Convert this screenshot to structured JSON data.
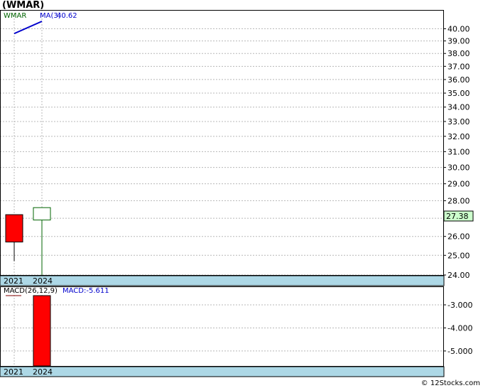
{
  "title": "(WMAR)",
  "footer": "© 12Stocks.com",
  "chart_data": [
    {
      "type": "candlestick",
      "ticker": "WMAR",
      "categories": [
        "2021",
        "2024"
      ],
      "candles": [
        {
          "x": "2021",
          "open": 27.2,
          "close": 25.7,
          "high": 27.2,
          "low": 24.7,
          "color": "#ff0000"
        },
        {
          "x": "2024",
          "open": 26.9,
          "close": 27.6,
          "high": 27.6,
          "low": 24.0,
          "color": "#ffffff"
        }
      ],
      "ma": {
        "label": "MA(3)",
        "value_label": "40.62",
        "values": [
          39.6,
          40.62
        ],
        "color": "#0000cc"
      },
      "last_price": "27.38",
      "ylim": [
        24.0,
        40.62
      ],
      "yticks": [
        "40.00",
        "39.00",
        "38.00",
        "37.00",
        "36.00",
        "35.00",
        "34.00",
        "33.00",
        "32.00",
        "31.00",
        "30.00",
        "29.00",
        "28.00",
        "27.00",
        "26.00",
        "25.00",
        "24.00"
      ],
      "ytick_values": [
        40,
        39,
        38,
        37,
        36,
        35,
        34,
        33,
        32,
        31,
        30,
        29,
        28,
        27,
        26,
        25,
        24
      ],
      "log_scale": true,
      "grid": true
    },
    {
      "type": "bar",
      "label": "MACD(26,12,9)",
      "value_label": "MACD:-5.611",
      "categories": [
        "2021",
        "2024"
      ],
      "bars": [
        {
          "x": "2024",
          "top": -2.6,
          "bottom": -5.65,
          "color": "#ff0000"
        }
      ],
      "ylim": [
        -5.65,
        -2.6
      ],
      "yticks": [
        "-3.000",
        "-4.000",
        "-5.000"
      ],
      "ytick_values": [
        -3,
        -4,
        -5
      ],
      "grid": true
    }
  ]
}
